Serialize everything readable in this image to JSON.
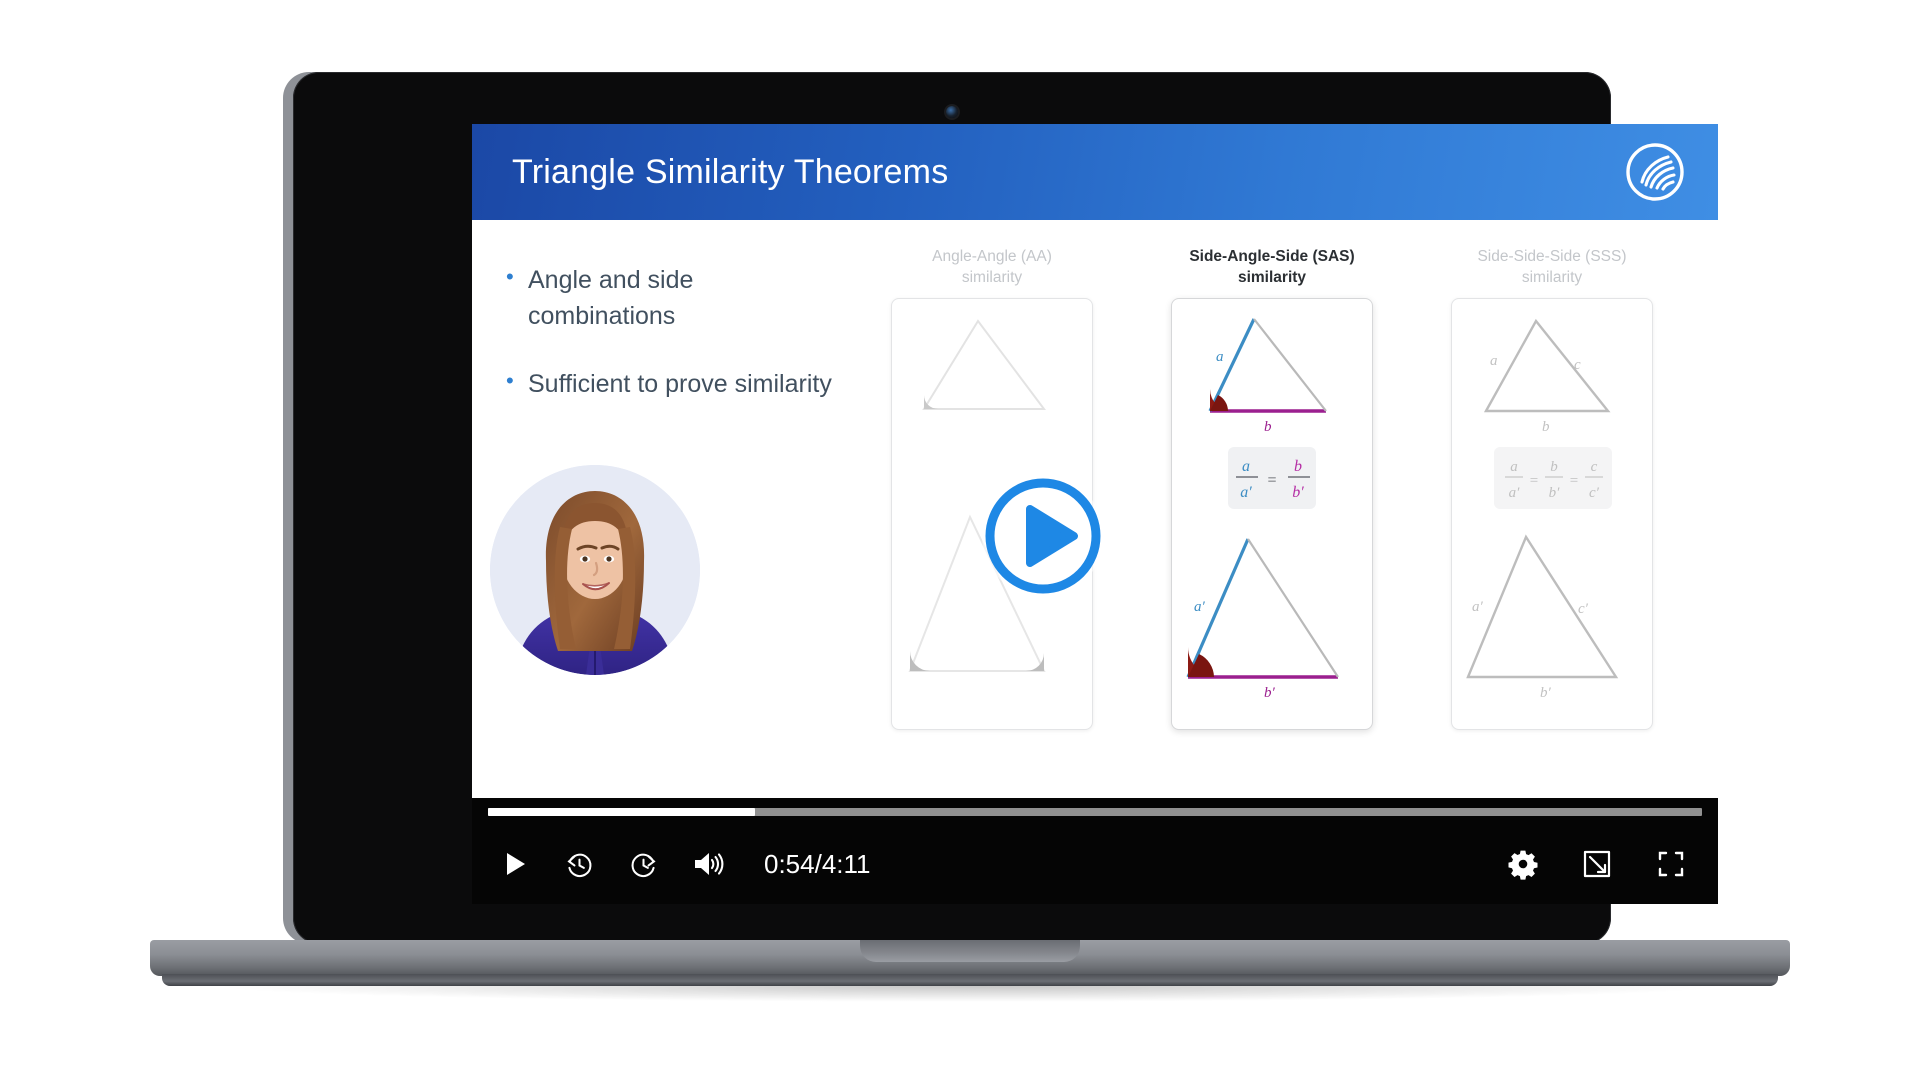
{
  "device": {
    "type": "laptop",
    "webcam_label": "webcam"
  },
  "slide": {
    "title": "Triangle Similarity Theorems",
    "logo_name": "swirl-logo-icon",
    "header_gradient_start": "#1b48a6",
    "header_gradient_end": "#3f8ee4",
    "bullets": [
      "Angle and side combinations",
      "Sufficient to prove similarity"
    ],
    "bullet_dot_color": "#2e7fd0",
    "bullet_text_color": "#41505f",
    "presenter_alt": "course instructor video feed"
  },
  "panels": [
    {
      "caption_line1": "Angle-Angle (AA)",
      "caption_line2": "similarity",
      "active": false,
      "labels": [],
      "formula": ""
    },
    {
      "caption_line1": "Side-Angle-Side (SAS)",
      "caption_line2": "similarity",
      "active": true,
      "labels": [
        "a",
        "b",
        "a'",
        "b'"
      ],
      "formula": "a/a' = b/b'",
      "side_color": "#3c8dc4",
      "base_color": "#9b1f8f",
      "angle_color": "#8c1a14"
    },
    {
      "caption_line1": "Side-Side-Side (SSS)",
      "caption_line2": "similarity",
      "active": false,
      "labels": [
        "a",
        "b",
        "c",
        "a'",
        "b'",
        "c'"
      ],
      "formula": "a/a' = b/b' = c/c'"
    }
  ],
  "player": {
    "play_overlay_name": "play-overlay-button",
    "play_color": "#1e88e5",
    "progress_percent": 22,
    "time_display": "0:54/4:11",
    "current_time": "0:54",
    "duration": "4:11",
    "controls_left": [
      {
        "name": "play-button",
        "label": "Play"
      },
      {
        "name": "rewind-10-button",
        "label": "Rewind"
      },
      {
        "name": "forward-10-button",
        "label": "Forward"
      },
      {
        "name": "volume-button",
        "label": "Volume"
      }
    ],
    "controls_right": [
      {
        "name": "settings-gear-button",
        "label": "Settings"
      },
      {
        "name": "theater-mode-button",
        "label": "Theater mode"
      },
      {
        "name": "fullscreen-button",
        "label": "Fullscreen"
      }
    ]
  }
}
